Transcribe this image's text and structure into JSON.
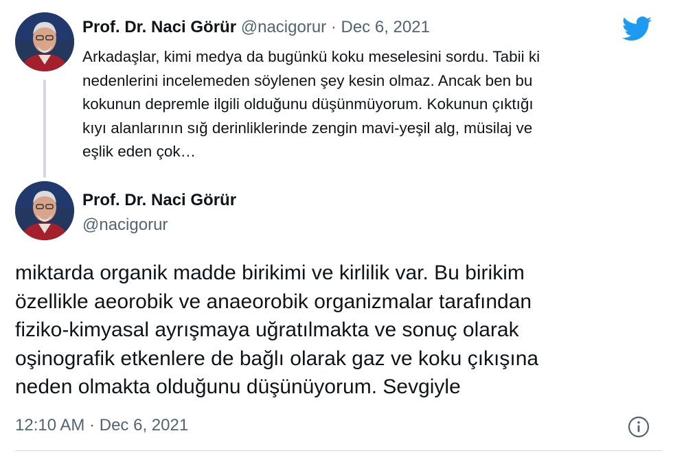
{
  "colors": {
    "text": "#0f1419",
    "secondary": "#536471",
    "twitter_blue": "#1d9bf0",
    "thread_line": "#cfd9de"
  },
  "parent_tweet": {
    "author_name": "Prof. Dr. Naci Görür",
    "handle": "@nacigorur",
    "separator": "·",
    "date": "Dec 6, 2021",
    "text_lines": [
      "Arkadaşlar, kimi medya da bugünkü koku meselesini sordu. Tabii ki",
      "nedenlerini incelemeden söylenen şey kesin olmaz. Ancak ben bu",
      "kokunun depremle ilgili olduğunu düşünmüyorum. Kokunun çıktığı",
      "kıyı alanlarının sığ derinliklerinde zengin mavi-yeşil alg, müsilaj ve",
      "eşlik eden çok…"
    ]
  },
  "main_tweet": {
    "author_name": "Prof. Dr. Naci Görür",
    "handle": "@nacigorur",
    "text_lines": [
      "miktarda organik madde birikimi ve kirlilik var. Bu birikim",
      "özellikle aeorobik ve anaeorobik organizmalar tarafından",
      "fiziko-kimyasal ayrışmaya uğratılmakta ve sonuç olarak",
      "oşinografik etkenlere de bağlı olarak gaz ve koku çıkışına",
      "neden olmakta olduğunu düşünüyorum. Sevgiyle"
    ],
    "time": "12:10 AM",
    "separator": "·",
    "date": "Dec 6, 2021"
  },
  "icons": {
    "logo": "twitter-bird-icon",
    "info": "info-icon"
  }
}
